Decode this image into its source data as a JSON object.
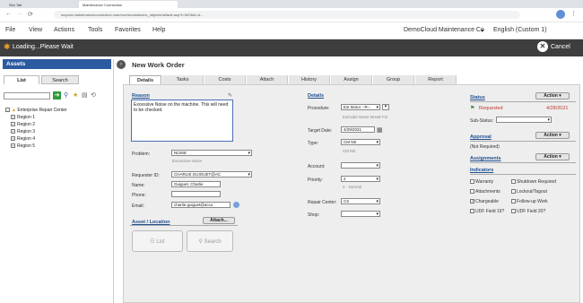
{
  "browser": {
    "tabs": [
      "Sim Tab",
      "Maintenance Connection"
    ],
    "url": "mcprod.maintenanceconnection.com/mcv/modules/mc_objects/default.asp?t=WO&id=&...",
    "menu": [
      "File",
      "View",
      "Actions",
      "Tools",
      "Favorites",
      "Help"
    ],
    "account": "DemoCloud Maintenance Co",
    "language": "English (Custom 1)"
  },
  "loading": {
    "text": "Loading...Please Wait",
    "cancel": "Cancel"
  },
  "left": {
    "title": "Assets",
    "tabs": [
      "List",
      "Search"
    ],
    "tree_root": "Enterprise Repair Center",
    "regions": [
      "Region 1",
      "Region 2",
      "Region 3",
      "Region 4",
      "Region 5"
    ]
  },
  "main": {
    "title": "New Work Order",
    "tabs": [
      "Details",
      "Tasks",
      "Costs",
      "Attach",
      "History",
      "Assign",
      "Group",
      "Report"
    ]
  },
  "reason": {
    "label": "Reason",
    "text": "Excessive Noise on the machine. This will need to be checked."
  },
  "problem": {
    "label": "Problem:",
    "value": "NOISE",
    "desc": "Excessive Noise"
  },
  "requester": {
    "id_label": "Requester ID:",
    "id": "CHARLIE.GUIGUET@AC",
    "name_label": "Name:",
    "name": "Guiguet, Charlie",
    "phone_label": "Phone:",
    "phone": "",
    "email_label": "Email:",
    "email": "charlie.guiguet@accu"
  },
  "asset_location": {
    "label": "Asset / Location",
    "attach": "Attach...",
    "list": "List",
    "search": "Search"
  },
  "details": {
    "label": "Details",
    "procedure_label": "Procedure:",
    "procedure": "Ext Motor --R--",
    "procedure_desc": "Extruder Motor Break Fix",
    "target_label": "Target Date:",
    "target": "4/29/2021",
    "type_label": "Type:",
    "type": "CM NE",
    "type_desc": "CM NE",
    "account_label": "Account:",
    "account": "",
    "priority_label": "Priority:",
    "priority": "2",
    "priority_desc": "2 - Normal",
    "repair_label": "Repair Center:",
    "repair": "CS",
    "shop_label": "Shop:",
    "shop": ""
  },
  "status": {
    "label": "Status",
    "action": "Action",
    "value": "Requested",
    "date": "4/28/2021",
    "substatus_label": "Sub-Status:"
  },
  "approval": {
    "label": "Approval",
    "action": "Action",
    "value": "(Not Required)"
  },
  "assignments": {
    "label": "Assignments",
    "action": "Action"
  },
  "indicators": {
    "label": "Indicators",
    "items": [
      "Warranty",
      "Shutdown Required",
      "Attachments",
      "Lockout/Tagout",
      "Chargeable",
      "Follow-up Work",
      "UDF Field 19?",
      "UDF Field 20?"
    ],
    "checked": "Chargeable"
  }
}
